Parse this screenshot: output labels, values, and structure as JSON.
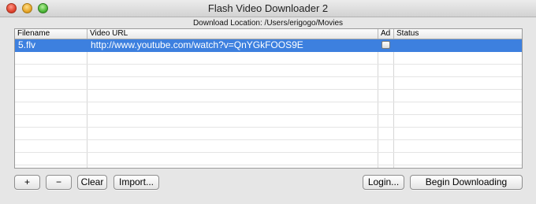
{
  "window": {
    "title": "Flash Video Downloader 2"
  },
  "location_label": "Download Location: /Users/erigogo/Movies",
  "table": {
    "columns": {
      "filename": "Filename",
      "url": "Video URL",
      "ad": "Ad",
      "status": "Status"
    },
    "rows": [
      {
        "filename": "5.flv",
        "url": "http://www.youtube.com/watch?v=QnYGkFOOS9E",
        "ad_checked": false,
        "status": "",
        "selected": true
      }
    ]
  },
  "toolbar": {
    "add_label": "+",
    "remove_label": "−",
    "clear_label": "Clear",
    "import_label": "Import...",
    "login_label": "Login...",
    "begin_label": "Begin Downloading"
  },
  "colors": {
    "selection": "#3d80df"
  }
}
